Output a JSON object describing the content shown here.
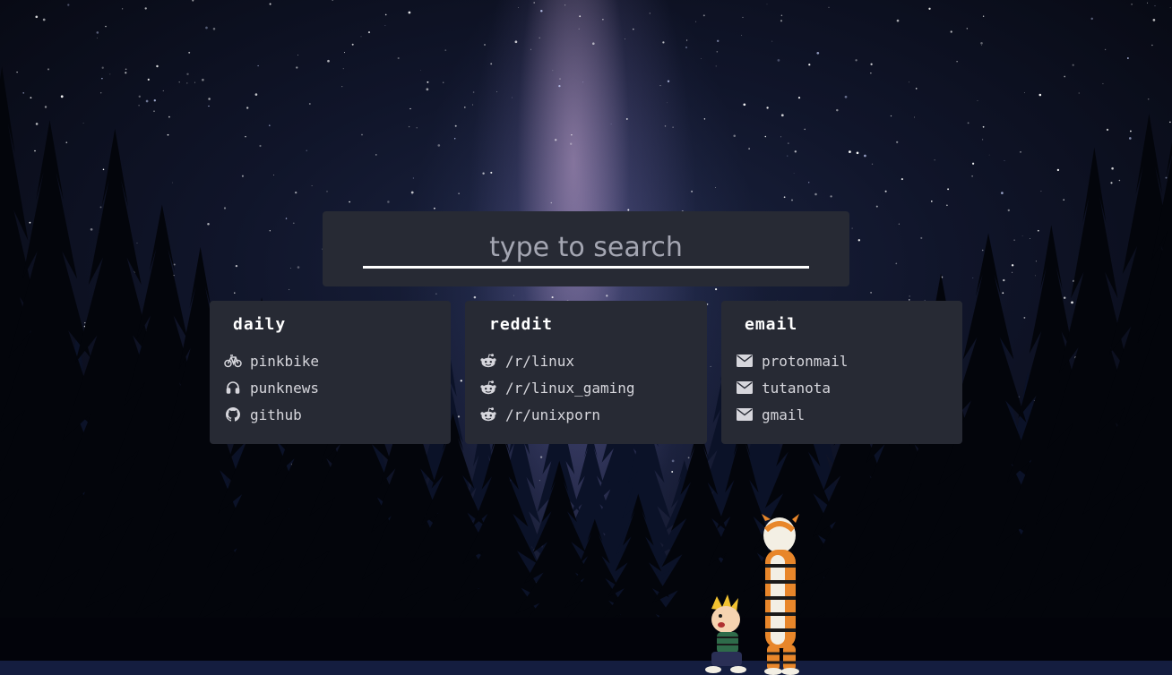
{
  "search": {
    "placeholder": "type to search",
    "value": ""
  },
  "cards": [
    {
      "title": "daily",
      "links": [
        {
          "label": "pinkbike",
          "icon": "bicycle-icon"
        },
        {
          "label": "punknews",
          "icon": "headphones-icon"
        },
        {
          "label": "github",
          "icon": "github-icon"
        }
      ]
    },
    {
      "title": "reddit",
      "links": [
        {
          "label": "/r/linux",
          "icon": "reddit-icon"
        },
        {
          "label": "/r/linux_gaming",
          "icon": "reddit-icon"
        },
        {
          "label": "/r/unixporn",
          "icon": "reddit-icon"
        }
      ]
    },
    {
      "title": "email",
      "links": [
        {
          "label": "protonmail",
          "icon": "envelope-icon"
        },
        {
          "label": "tutanota",
          "icon": "envelope-icon"
        },
        {
          "label": "gmail",
          "icon": "envelope-icon"
        }
      ]
    }
  ],
  "colors": {
    "panel_background": "#272a34",
    "text": "#d6d6dc",
    "title": "#ffffff",
    "search_underline": "#ffffff",
    "placeholder": "#a4a6b2"
  }
}
